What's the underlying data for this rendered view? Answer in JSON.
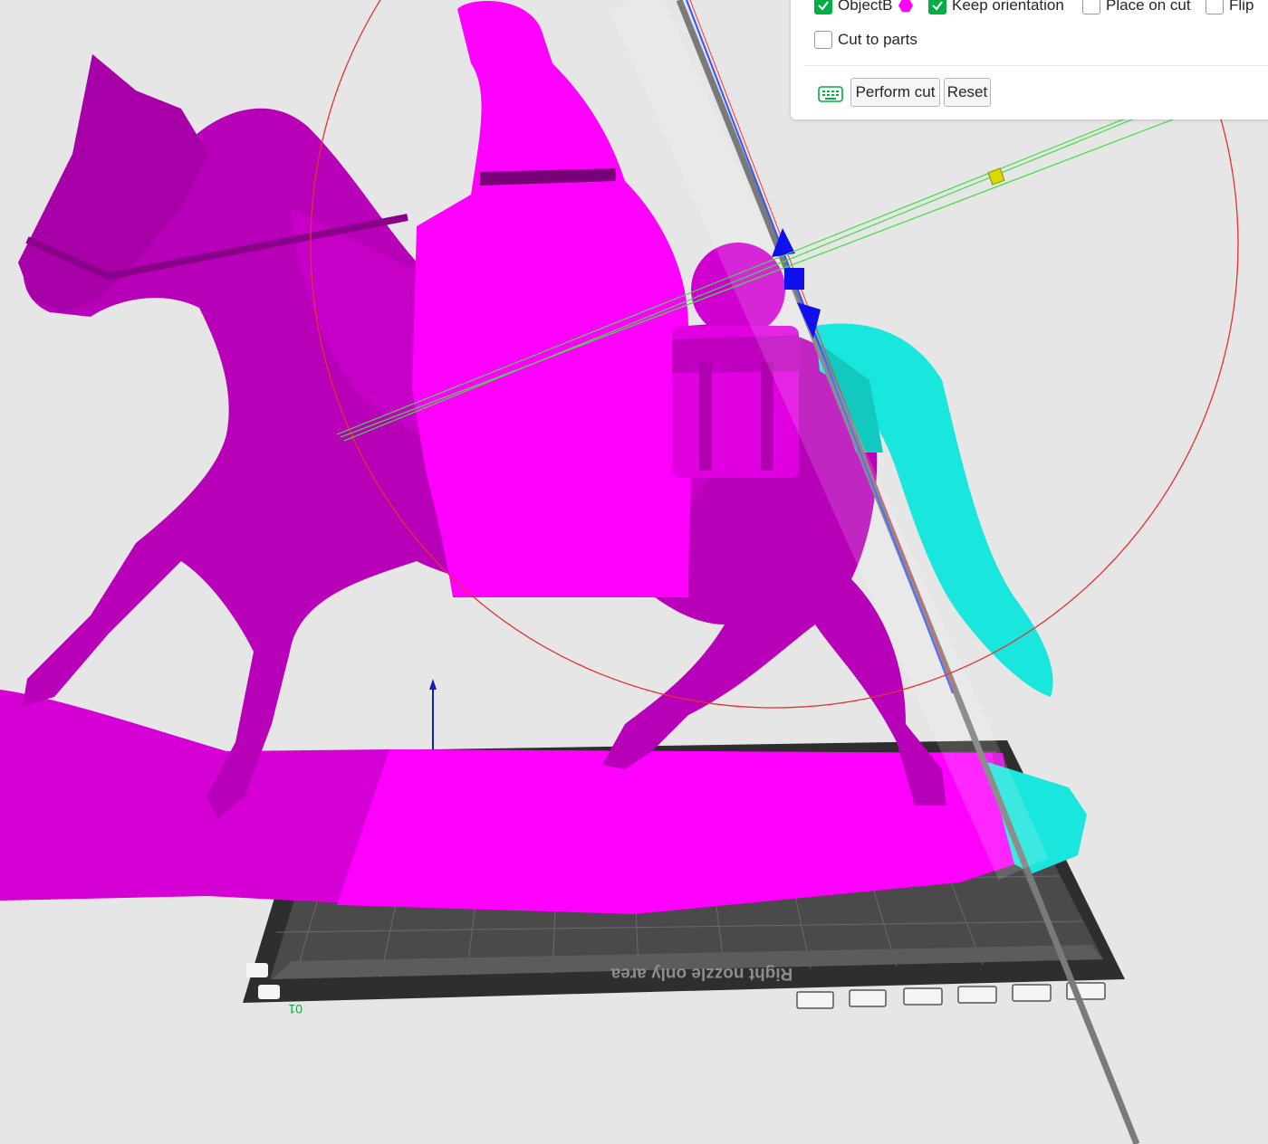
{
  "cut_panel": {
    "options": {
      "object_b": {
        "label": "ObjectB",
        "checked": true
      },
      "keep_orientation": {
        "label": "Keep orientation",
        "checked": true
      },
      "place_on_cut": {
        "label": "Place on cut",
        "checked": false
      },
      "flip": {
        "label": "Flip",
        "checked": false
      },
      "cut_to_parts": {
        "label": "Cut to parts",
        "checked": false
      }
    },
    "object_b_color": "#ff00ff",
    "buttons": {
      "perform_cut": "Perform cut",
      "reset": "Reset"
    },
    "icons": {
      "keyboard": "keyboard-icon"
    }
  },
  "scene": {
    "plate_label": "Right nozzle only area",
    "plate_number": "01",
    "part_a_color": "#ff00ff",
    "part_b_color": "#19e6dc",
    "accent_color": "#00ae42"
  }
}
